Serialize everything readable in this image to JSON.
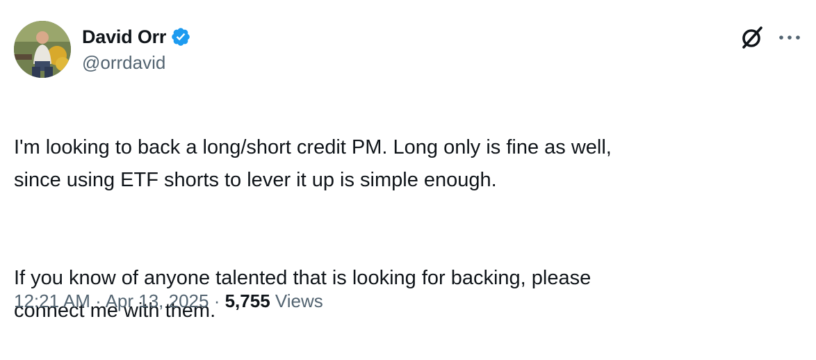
{
  "author": {
    "display_name": "David Orr",
    "handle": "@orrdavid",
    "verified": true,
    "verified_color": "#1d9bf0"
  },
  "tweet": {
    "paragraphs": [
      "I'm looking to back a long/short credit PM.  Long only is fine as well,\nsince using ETF shorts to lever it up is simple enough.",
      "If you know of anyone talented that is looking for backing, please\nconnect me with them."
    ],
    "time": "12:21 AM",
    "date": "Apr 13, 2025",
    "separator": "·",
    "views_count": "5,755",
    "views_label": "Views"
  },
  "icons": {
    "avatar": "avatar-photo",
    "verified": "verified-badge-icon",
    "grok": "grok-icon",
    "more": "more-dots-icon"
  },
  "colors": {
    "text_primary": "#0f1419",
    "text_secondary": "#536471",
    "accent": "#1d9bf0"
  }
}
